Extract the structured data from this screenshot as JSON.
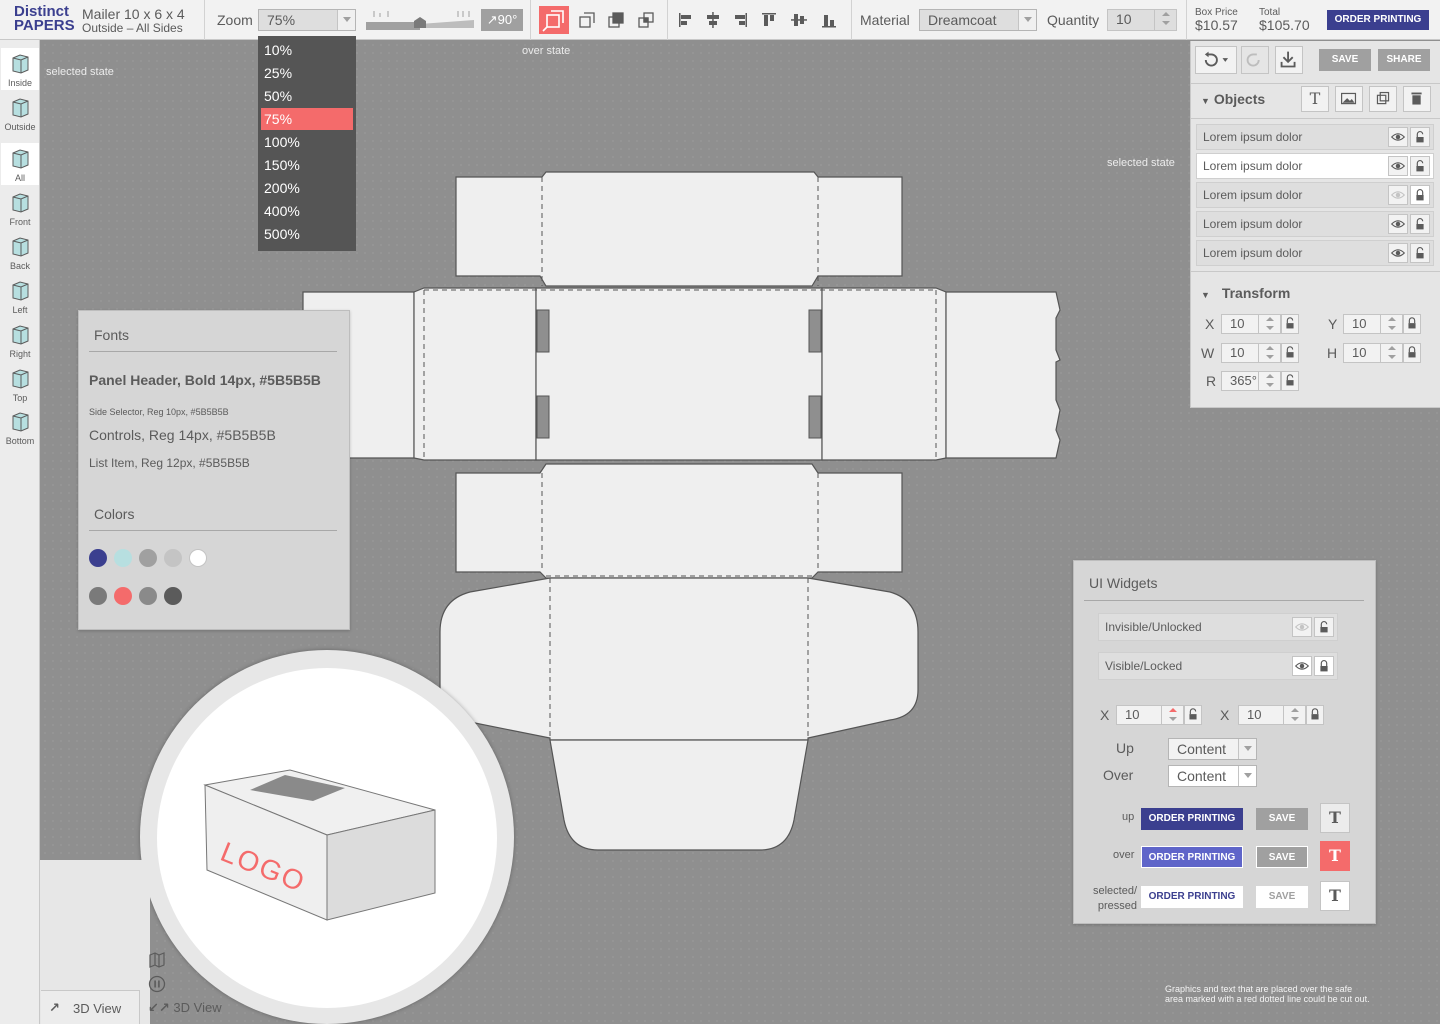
{
  "brand": {
    "line1": "Distinct",
    "line2": "PAPERS"
  },
  "product": {
    "name": "Mailer 10 x 6 x 4",
    "sides": "Outside – All Sides"
  },
  "toolbar": {
    "zoom_label": "Zoom",
    "zoom_value": "75%",
    "zoom_slider_level": 0.5,
    "rotate_label": "90°",
    "material_label": "Material",
    "material_value": "Dreamcoat",
    "quantity_label": "Quantity",
    "quantity_value": "10",
    "box_price_label": "Box Price",
    "box_price_value": "$10.57",
    "total_label": "Total",
    "total_value": "$105.70",
    "order_button": "ORDER PRINTING"
  },
  "zoom_options": [
    "10%",
    "25%",
    "50%",
    "75%",
    "100%",
    "150%",
    "200%",
    "400%",
    "500%"
  ],
  "zoom_selected": "75%",
  "sidebar": {
    "items": [
      {
        "label": "Inside",
        "selected": true
      },
      {
        "label": "Outside",
        "selected": false
      },
      {
        "label": "All",
        "selected": true
      },
      {
        "label": "Front",
        "selected": false
      },
      {
        "label": "Back",
        "selected": false
      },
      {
        "label": "Left",
        "selected": false
      },
      {
        "label": "Right",
        "selected": false
      },
      {
        "label": "Top",
        "selected": false
      },
      {
        "label": "Bottom",
        "selected": false
      }
    ]
  },
  "notes": {
    "selected_state_left": "selected state",
    "over_state": "over state",
    "selected_state_right": "selected state",
    "safe_area_line1": "Graphics and text that are placed over the safe",
    "safe_area_line2": "area marked with a red dotted line could be cut out."
  },
  "right_panel": {
    "save_button": "SAVE",
    "share_button": "SHARE",
    "objects_header": "Objects",
    "objects": [
      {
        "label": "Lorem ipsum dolor",
        "selected": false,
        "visible": true,
        "locked": false
      },
      {
        "label": "Lorem ipsum dolor",
        "selected": true,
        "visible": true,
        "locked": false
      },
      {
        "label": "Lorem ipsum dolor",
        "selected": false,
        "visible": false,
        "locked": true
      },
      {
        "label": "Lorem ipsum dolor",
        "selected": false,
        "visible": true,
        "locked": false
      },
      {
        "label": "Lorem ipsum dolor",
        "selected": false,
        "visible": true,
        "locked": false
      }
    ],
    "transform_header": "Transform",
    "transform": {
      "x_label": "X",
      "x_value": "10",
      "y_label": "Y",
      "y_value": "10",
      "w_label": "W",
      "w_value": "10",
      "h_label": "H",
      "h_value": "10",
      "r_label": "R",
      "r_value": "365°"
    }
  },
  "fonts_panel": {
    "fonts_header": "Fonts",
    "panel_header_spec": "Panel Header, Bold 14px,  #5B5B5B",
    "side_selector_spec": "Side Selector, Reg 10px,  #5B5B5B",
    "controls_spec": "Controls, Reg 14px,  #5B5B5B",
    "list_item_spec": "List Item, Reg 12px,  #5B5B5B",
    "colors_header": "Colors",
    "colors_row1": [
      "#3b3f8f",
      "#b7dfe0",
      "#a0a0a0",
      "#c4c4c4",
      "#ffffff"
    ],
    "colors_row2": [
      "#7a7a7a",
      "#f46b6b",
      "#8a8a8a",
      "#5b5b5b"
    ]
  },
  "widgets_panel": {
    "header": "UI Widgets",
    "invisible_unlocked": "Invisible/Unlocked",
    "visible_locked": "Visible/Locked",
    "x_label_1": "X",
    "x_value_1": "10",
    "x_label_2": "X",
    "x_value_2": "10",
    "up_label": "Up",
    "up_value": "Content",
    "over_label": "Over",
    "over_value": "Content",
    "state_up": "up",
    "state_over": "over",
    "state_selected_1": "selected/",
    "state_selected_2": "pressed",
    "order_button": "ORDER PRINTING",
    "save_button": "SAVE",
    "text_tool": "T"
  },
  "view3d": {
    "logo_text": "LOGO",
    "label": "3D View",
    "label_small": "3D View"
  }
}
